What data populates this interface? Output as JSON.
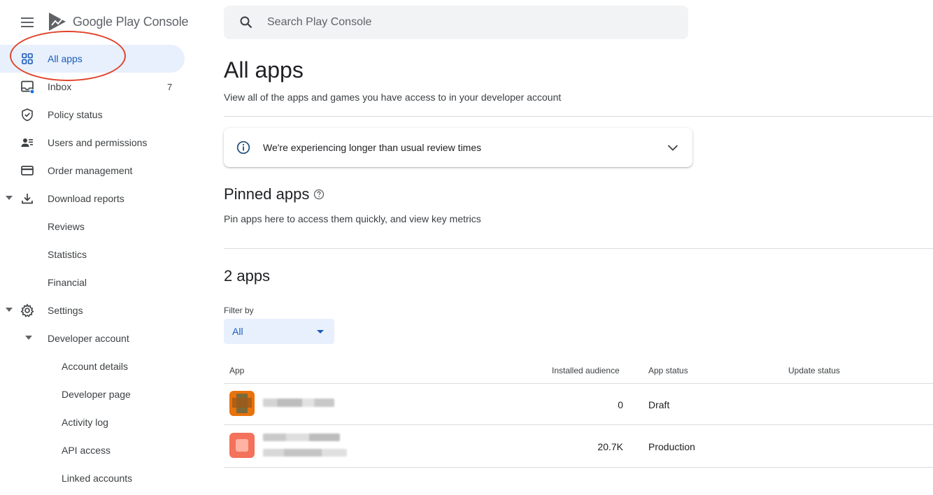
{
  "brand": {
    "name_main": "Google Play",
    "name_sub": "Console"
  },
  "search": {
    "placeholder": "Search Play Console"
  },
  "sidebar": {
    "items": [
      {
        "label": "All apps",
        "icon": "grid-icon",
        "active": true
      },
      {
        "label": "Inbox",
        "icon": "inbox-icon",
        "badge": "7"
      },
      {
        "label": "Policy status",
        "icon": "shield-icon"
      },
      {
        "label": "Users and permissions",
        "icon": "users-icon"
      },
      {
        "label": "Order management",
        "icon": "credit-card-icon"
      },
      {
        "label": "Download reports",
        "icon": "download-icon",
        "expanded": true
      },
      {
        "label": "Reviews"
      },
      {
        "label": "Statistics"
      },
      {
        "label": "Financial"
      },
      {
        "label": "Settings",
        "icon": "gear-icon",
        "expanded": true
      },
      {
        "label": "Developer account",
        "expanded": true
      },
      {
        "label": "Account details"
      },
      {
        "label": "Developer page"
      },
      {
        "label": "Activity log"
      },
      {
        "label": "API access"
      },
      {
        "label": "Linked accounts"
      }
    ]
  },
  "main": {
    "title": "All apps",
    "subtitle": "View all of the apps and games you have access to in your developer account",
    "alert": {
      "text": "We're experiencing longer than usual review times"
    },
    "pinned": {
      "title": "Pinned apps",
      "subtitle": "Pin apps here to access them quickly, and view key metrics"
    },
    "apps_count_title": "2 apps",
    "filter": {
      "label": "Filter by",
      "value": "All"
    },
    "table": {
      "headers": [
        "App",
        "Installed audience",
        "App status",
        "Update status"
      ],
      "rows": [
        {
          "installed_audience": "0",
          "app_status": "Draft",
          "update_status": ""
        },
        {
          "installed_audience": "20.7K",
          "app_status": "Production",
          "update_status": ""
        }
      ]
    }
  },
  "colors": {
    "accent": "#1a5cb8",
    "active_bg": "#e8f0fe",
    "annotation": "#e0442a",
    "icon_gray": "#5f6368"
  }
}
